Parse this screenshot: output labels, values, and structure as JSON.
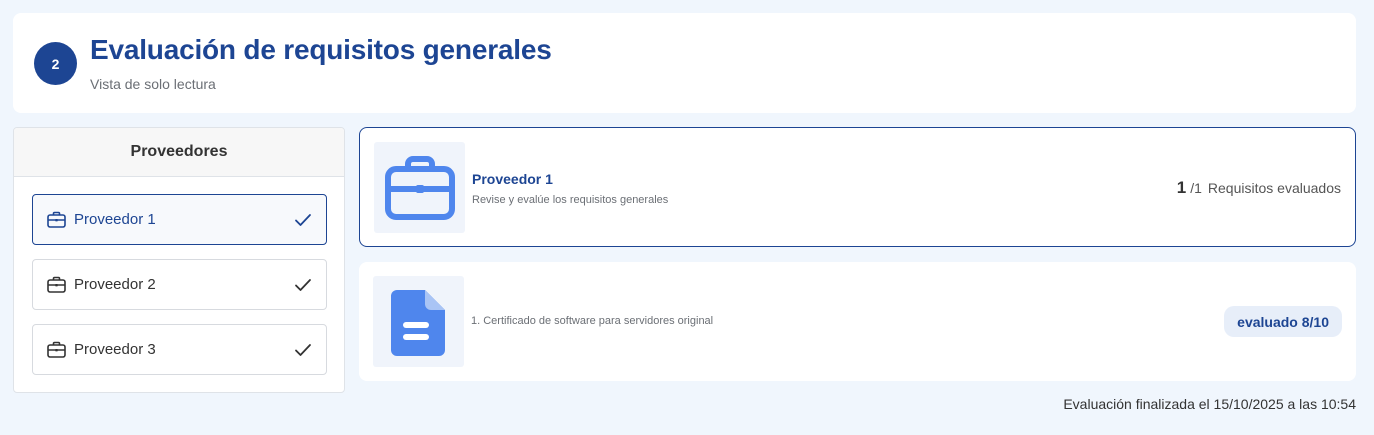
{
  "header": {
    "step_number": "2",
    "title": "Evaluación de requisitos generales",
    "subtitle": "Vista de solo lectura"
  },
  "sidebar": {
    "title": "Proveedores",
    "items": [
      {
        "label": "Proveedor 1",
        "active": true,
        "checked": true
      },
      {
        "label": "Proveedor 2",
        "active": false,
        "checked": true
      },
      {
        "label": "Proveedor 3",
        "active": false,
        "checked": true
      }
    ]
  },
  "provider": {
    "name": "Proveedor 1",
    "description": "Revise y evalúe los requisitos generales",
    "evaluated_count": "1",
    "total": "/1",
    "count_label": "Requisitos evaluados",
    "icon": "briefcase-icon"
  },
  "requirements": [
    {
      "text": "1. Certificado de software para servidores original",
      "status": "evaluado 8/10",
      "icon": "document-icon"
    }
  ],
  "footer": {
    "note": "Evaluación finalizada el 15/10/2025 a las 10:54"
  },
  "colors": {
    "primary": "#1d4593",
    "icon_blue": "#4f86ed",
    "background": "#f0f6fd",
    "tile": "#f0f4fb",
    "pill_bg": "#e7eef9"
  }
}
